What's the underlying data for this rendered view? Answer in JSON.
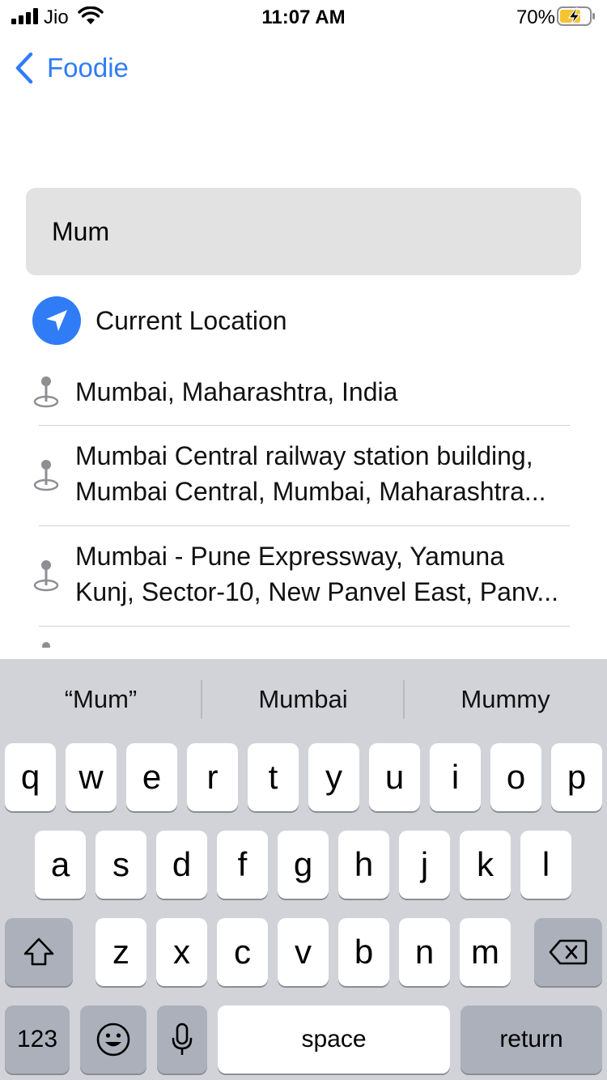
{
  "status_bar": {
    "carrier": "Jio",
    "time": "11:07 AM",
    "battery_percent": "70%",
    "battery_level": 0.7,
    "icons": [
      "signal-icon",
      "wifi-icon",
      "battery-charging-icon"
    ]
  },
  "nav": {
    "back_label": "Foodie"
  },
  "search": {
    "value": "Mum"
  },
  "current_location": {
    "label": "Current Location",
    "icon": "location-arrow-icon"
  },
  "results": [
    {
      "lines": [
        "Mumbai, Maharashtra, India"
      ]
    },
    {
      "lines": [
        "Mumbai Central railway station building,",
        "Mumbai Central, Mumbai, Maharashtra..."
      ]
    },
    {
      "lines": [
        "Mumbai - Pune Expressway, Yamuna",
        "Kunj, Sector-10, New Panvel East, Panv..."
      ]
    }
  ],
  "keyboard": {
    "suggestions": [
      "“Mum”",
      "Mumbai",
      "Mummy"
    ],
    "row1": [
      "q",
      "w",
      "e",
      "r",
      "t",
      "y",
      "u",
      "i",
      "o",
      "p"
    ],
    "row2": [
      "a",
      "s",
      "d",
      "f",
      "g",
      "h",
      "j",
      "k",
      "l"
    ],
    "row3": [
      "z",
      "x",
      "c",
      "v",
      "b",
      "n",
      "m"
    ],
    "numbers_label": "123",
    "space_label": "space",
    "return_label": "return",
    "icons": [
      "shift-icon",
      "delete-icon",
      "emoji-icon",
      "microphone-icon"
    ]
  },
  "colors": {
    "accent": "#2f7cf6",
    "keyboard_bg": "#d1d3d9",
    "search_bg": "#e2e2e3"
  }
}
